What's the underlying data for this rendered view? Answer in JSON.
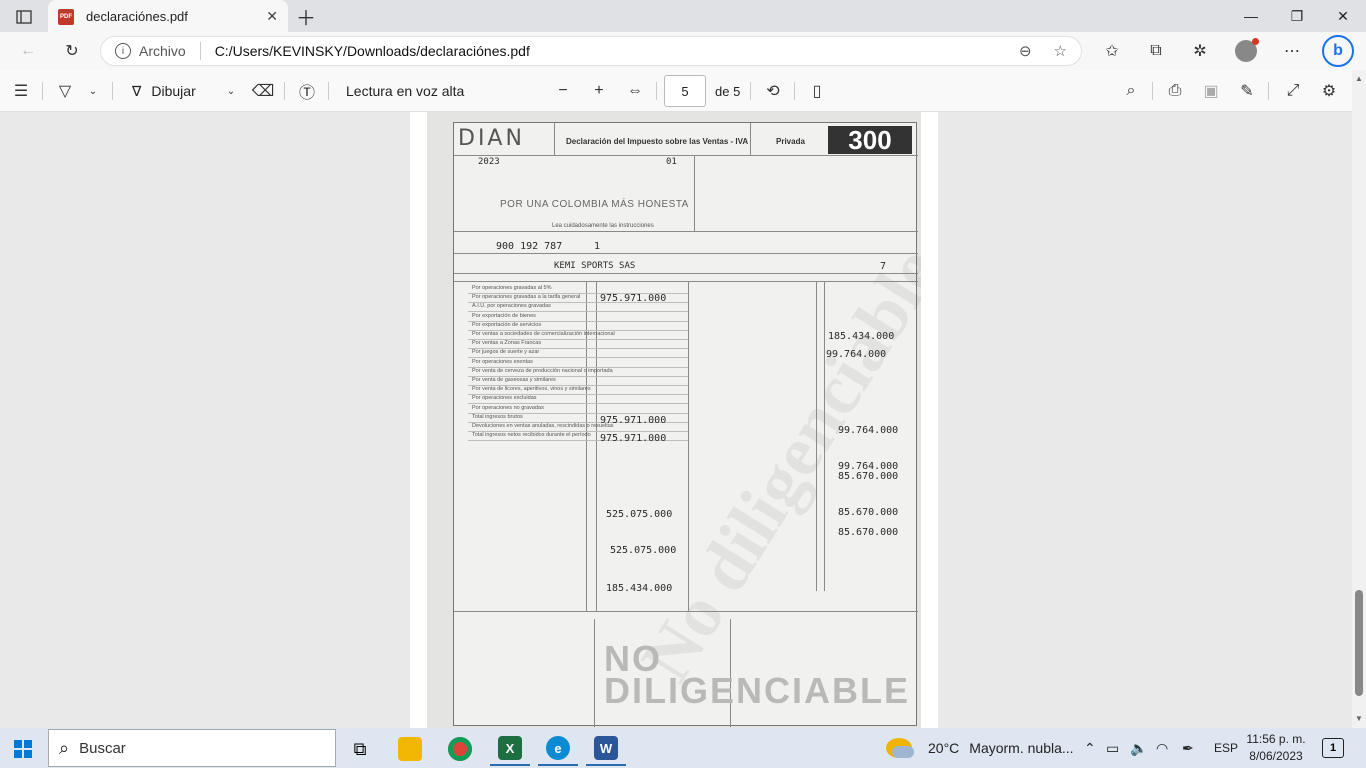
{
  "browser": {
    "tab_title": "declaraciónes.pdf",
    "site_label": "Archivo",
    "url": "C:/Users/KEVINSKY/Downloads/declaraciónes.pdf"
  },
  "pdf_toolbar": {
    "draw_label": "Dibujar",
    "read_aloud_label": "Lectura en voz alta",
    "current_page": "5",
    "total_pages": "de 5"
  },
  "document": {
    "logo": "DIAN",
    "form_title": "Declaración del Impuesto sobre las Ventas - IVA",
    "privacy": "Privada",
    "form_number": "300",
    "slogan": "POR UNA COLOMBIA MÁS HONESTA",
    "instructions": "Lea cuidadosamente las instrucciones",
    "year": "2023",
    "period": "01",
    "nit": "900 192 787",
    "dv": "1",
    "company": "KEMI SPORTS SAS",
    "section_code": "7",
    "values_left": {
      "r28": "975.971.000",
      "r41": "975.971.000",
      "r43": "975.971.000",
      "r51": "525.075.000",
      "r55": "525.075.000",
      "r59": "185.434.000"
    },
    "values_right": {
      "r67": "185.434.000",
      "r69": "99.764.000",
      "r77": "99.764.000",
      "r81": "99.764.000",
      "r82": "85.670.000",
      "r88": "85.670.000",
      "r89": "85.670.000"
    },
    "stamp_line1": "NO",
    "stamp_line2": "DILIGENCIABLE",
    "watermark": "No diligenciable",
    "labels_left": [
      "Por operaciones gravadas al 5%",
      "Por operaciones gravadas a la tarifa general",
      "A.I.U. por operaciones gravadas",
      "Por exportación de bienes",
      "Por exportación de servicios",
      "Por ventas a sociedades de comercialización internacional",
      "Por ventas a Zonas Francas",
      "Por juegos de suerte y azar",
      "Por operaciones exentas",
      "Por venta de cerveza de producción nacional o importada",
      "Por venta de gaseosas y similares",
      "Por venta de licores, aperitivos, vinos y similares",
      "Por operaciones excluidas",
      "Por operaciones no gravadas",
      "Total ingresos brutos",
      "Devoluciones en ventas anuladas, rescindidas o resueltas",
      "Total ingresos netos recibidos durante el período"
    ]
  },
  "taskbar": {
    "search_placeholder": "Buscar",
    "weather_temp": "20°C",
    "weather_desc": "Mayorm. nubla...",
    "language": "ESP",
    "time": "11:56 p. m.",
    "date": "8/06/2023",
    "notifications": "1"
  }
}
